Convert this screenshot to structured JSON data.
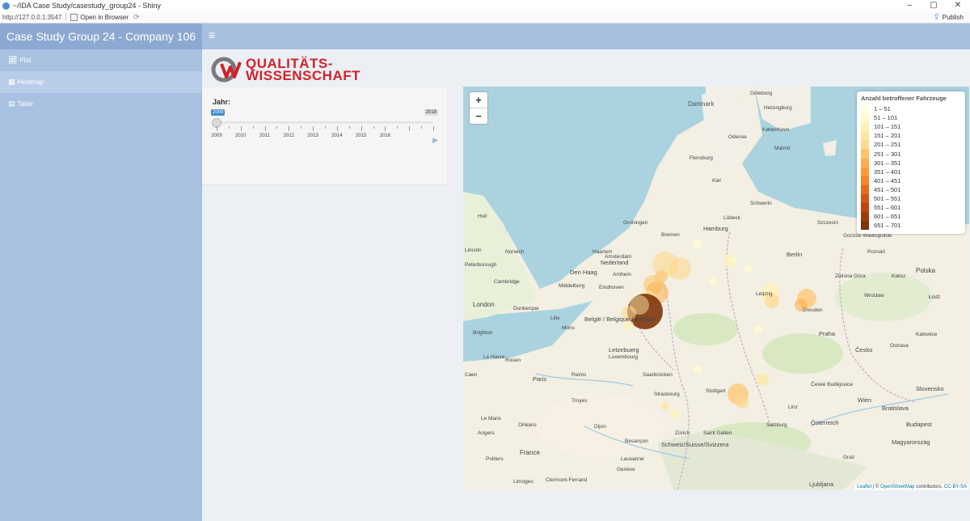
{
  "window": {
    "title": "~/IDA Case Study/casestudy_group24 - Shiny",
    "url": "http://127.0.0.1:3547",
    "open_in_browser": "Open in Browser",
    "publish": "Publish"
  },
  "header": {
    "title": "Case Study Group 24 - Company 106",
    "toggle": "≡"
  },
  "sidebar": {
    "items": [
      {
        "label": "Plot",
        "icon": "line-chart-icon"
      },
      {
        "label": "Heatmap",
        "icon": "map-icon"
      },
      {
        "label": "Table",
        "icon": "table-icon"
      }
    ]
  },
  "brand": {
    "line1": "QUALITÄTS-",
    "line2": "WISSENSCHAFT"
  },
  "slider": {
    "label": "Jahr:",
    "min": "2009",
    "max": "2018",
    "value": "2009",
    "ticks": [
      "2009",
      "2010",
      "2011",
      "2012",
      "2013",
      "2014",
      "2015",
      "2016"
    ]
  },
  "map": {
    "zoom_in": "+",
    "zoom_out": "−",
    "attribution": {
      "leaflet": "Leaflet",
      "sep": "| ©",
      "osm": "OpenStreetMap",
      "contributors": "contributors,",
      "license": "CC-BY-SA"
    },
    "labels": [
      "Danmark",
      "København",
      "Helsingborg",
      "Göteborg",
      "Malmö",
      "Odense",
      "Flensburg",
      "Kiel",
      "Lübeck",
      "Schwerin",
      "Hamburg",
      "Bremen",
      "Groningen",
      "Hull",
      "Lincoln",
      "Norwich",
      "Peterborough",
      "Cambridge",
      "London",
      "Brighton",
      "Haarlem",
      "Amsterdam",
      "Den Haag",
      "Nederland",
      "Arnhem",
      "Eindhoven",
      "Middelburg",
      "Lille",
      "België / Belgique / Belgien",
      "Mons",
      "Dunkerque",
      "Le Havre",
      "Rouen",
      "Caen",
      "Paris",
      "Reims",
      "Troyes",
      "Le Mans",
      "Angers",
      "France",
      "Poitiers",
      "Orléans",
      "Limoges",
      "Clermont-Ferrand",
      "Dijon",
      "Besançon",
      "Genève",
      "Lausanne",
      "Schweiz/Suisse/Svizzera",
      "Zürich",
      "Saint Gallen",
      "Stuttgart",
      "Saarbrücken",
      "Luxembourg",
      "Letzebuerg",
      "Strasbourg",
      "Praha",
      "Česko",
      "České Budějovice",
      "Wien",
      "Österreich",
      "Bratislava",
      "Slovensko",
      "Budapest",
      "Magyarország",
      "Katowice",
      "Ostrava",
      "Polska",
      "Poznań",
      "Łódź",
      "Szczecin",
      "Berlin",
      "Dresden",
      "Leipzig",
      "Wrocław",
      "Gorzów Wielkopolski",
      "Zielona Góra",
      "Kalisz",
      "Ljubljana",
      "Graz",
      "Linz",
      "Salzburg"
    ],
    "legend": {
      "title": "Anzahl betroffener Fahrzeuge",
      "entries": [
        "1 – 51",
        "51 – 101",
        "101 – 151",
        "151 – 201",
        "201 – 251",
        "251 – 301",
        "301 – 351",
        "351 – 401",
        "401 – 451",
        "451 – 501",
        "501 – 551",
        "551 – 601",
        "601 – 651",
        "651 – 701"
      ],
      "colors": [
        "#ffffe5",
        "#fff9d1",
        "#fff2b8",
        "#fee7a3",
        "#fed98e",
        "#fec46c",
        "#feaf4d",
        "#fe9a33",
        "#f7832a",
        "#ea6a1d",
        "#d65514",
        "#bd470f",
        "#9c3e0b",
        "#7d350c"
      ]
    }
  }
}
